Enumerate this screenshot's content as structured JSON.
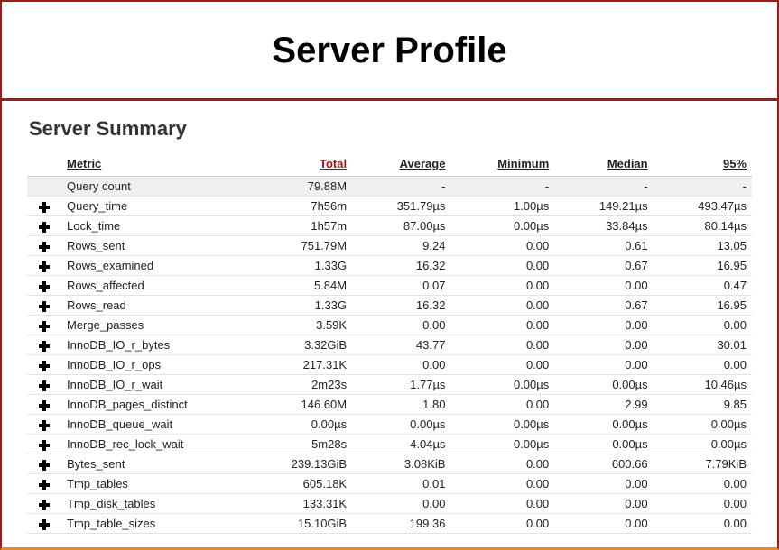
{
  "title": "Server Profile",
  "section_title": "Server Summary",
  "columns": {
    "metric": "Metric",
    "total": "Total",
    "average": "Average",
    "minimum": "Minimum",
    "median": "Median",
    "p95": "95%"
  },
  "rows": [
    {
      "expandable": false,
      "highlight": true,
      "metric": "Query count",
      "total": "79.88M",
      "average": "-",
      "minimum": "-",
      "median": "-",
      "p95": "-"
    },
    {
      "expandable": true,
      "highlight": false,
      "metric": "Query_time",
      "total": "7h56m",
      "average": "351.79µs",
      "minimum": "1.00µs",
      "median": "149.21µs",
      "p95": "493.47µs"
    },
    {
      "expandable": true,
      "highlight": false,
      "metric": "Lock_time",
      "total": "1h57m",
      "average": "87.00µs",
      "minimum": "0.00µs",
      "median": "33.84µs",
      "p95": "80.14µs"
    },
    {
      "expandable": true,
      "highlight": false,
      "metric": "Rows_sent",
      "total": "751.79M",
      "average": "9.24",
      "minimum": "0.00",
      "median": "0.61",
      "p95": "13.05"
    },
    {
      "expandable": true,
      "highlight": false,
      "metric": "Rows_examined",
      "total": "1.33G",
      "average": "16.32",
      "minimum": "0.00",
      "median": "0.67",
      "p95": "16.95"
    },
    {
      "expandable": true,
      "highlight": false,
      "metric": "Rows_affected",
      "total": "5.84M",
      "average": "0.07",
      "minimum": "0.00",
      "median": "0.00",
      "p95": "0.47"
    },
    {
      "expandable": true,
      "highlight": false,
      "metric": "Rows_read",
      "total": "1.33G",
      "average": "16.32",
      "minimum": "0.00",
      "median": "0.67",
      "p95": "16.95"
    },
    {
      "expandable": true,
      "highlight": false,
      "metric": "Merge_passes",
      "total": "3.59K",
      "average": "0.00",
      "minimum": "0.00",
      "median": "0.00",
      "p95": "0.00"
    },
    {
      "expandable": true,
      "highlight": false,
      "metric": "InnoDB_IO_r_bytes",
      "total": "3.32GiB",
      "average": "43.77",
      "minimum": "0.00",
      "median": "0.00",
      "p95": "30.01"
    },
    {
      "expandable": true,
      "highlight": false,
      "metric": "InnoDB_IO_r_ops",
      "total": "217.31K",
      "average": "0.00",
      "minimum": "0.00",
      "median": "0.00",
      "p95": "0.00"
    },
    {
      "expandable": true,
      "highlight": false,
      "metric": "InnoDB_IO_r_wait",
      "total": "2m23s",
      "average": "1.77µs",
      "minimum": "0.00µs",
      "median": "0.00µs",
      "p95": "10.46µs"
    },
    {
      "expandable": true,
      "highlight": false,
      "metric": "InnoDB_pages_distinct",
      "total": "146.60M",
      "average": "1.80",
      "minimum": "0.00",
      "median": "2.99",
      "p95": "9.85"
    },
    {
      "expandable": true,
      "highlight": false,
      "metric": "InnoDB_queue_wait",
      "total": "0.00µs",
      "average": "0.00µs",
      "minimum": "0.00µs",
      "median": "0.00µs",
      "p95": "0.00µs"
    },
    {
      "expandable": true,
      "highlight": false,
      "metric": "InnoDB_rec_lock_wait",
      "total": "5m28s",
      "average": "4.04µs",
      "minimum": "0.00µs",
      "median": "0.00µs",
      "p95": "0.00µs"
    },
    {
      "expandable": true,
      "highlight": false,
      "metric": "Bytes_sent",
      "total": "239.13GiB",
      "average": "3.08KiB",
      "minimum": "0.00",
      "median": "600.66",
      "p95": "7.79KiB"
    },
    {
      "expandable": true,
      "highlight": false,
      "metric": "Tmp_tables",
      "total": "605.18K",
      "average": "0.01",
      "minimum": "0.00",
      "median": "0.00",
      "p95": "0.00"
    },
    {
      "expandable": true,
      "highlight": false,
      "metric": "Tmp_disk_tables",
      "total": "133.31K",
      "average": "0.00",
      "minimum": "0.00",
      "median": "0.00",
      "p95": "0.00"
    },
    {
      "expandable": true,
      "highlight": false,
      "metric": "Tmp_table_sizes",
      "total": "15.10GiB",
      "average": "199.36",
      "minimum": "0.00",
      "median": "0.00",
      "p95": "0.00"
    }
  ]
}
